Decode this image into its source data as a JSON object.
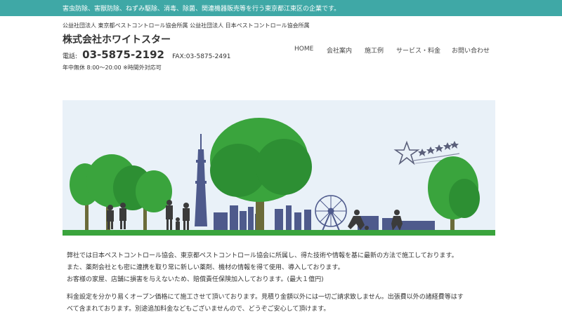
{
  "topbar": {
    "text": "害虫防除、害獣防除、ねずみ駆除、消毒、除菌、関連機器販売等を行う東京都江東区の企業です。"
  },
  "header": {
    "associations": "公益社団法人 東京都ペストコントロール協会所属 公益社団法人 日本ペストコントロール協会所属",
    "company_name": "株式会社ホワイトスター",
    "phone_label": "電話:",
    "phone_number": "03-5875-2192",
    "fax": "FAX:03-5875-2491",
    "hours": "年中無休 8:00～20:00 ※時間外対応可"
  },
  "nav": {
    "items": [
      {
        "label": "HOME"
      },
      {
        "label": "会社案内"
      },
      {
        "label": "施工例"
      },
      {
        "label": "サービス・料金"
      },
      {
        "label": "お問い合わせ"
      }
    ]
  },
  "hero": {
    "colors": {
      "sky": "#e9f1f8",
      "tree": "#3aa43d",
      "tree_dark": "#2d8f33",
      "trunk": "#6b6b3a",
      "city": "#4e5a8c",
      "people": "#3b3b3b",
      "grass": "#3aa43d"
    }
  },
  "content": {
    "paragraph1": [
      "弊社では日本ペストコントロール協会、東京都ペストコントロール協会に所属し、得た技術や情報を基に最新の方法で施工しております。",
      "また、薬剤会社とも密に連携を取り常に新しい薬剤、機材の情報を得て使用、導入しております。",
      "お客様の家屋、店舗に損害を与えないため、賠償責任保険加入しております。(最大１億円)"
    ],
    "paragraph2": [
      "料金設定を分かり易くオープン価格にて施工させて頂いております。見積り金額以外には一切ご請求致しません。出張費以外の諸経費等はす",
      "べて含まれております。別途追加料金などもございませんので、どうぞご安心して頂けます。"
    ]
  }
}
